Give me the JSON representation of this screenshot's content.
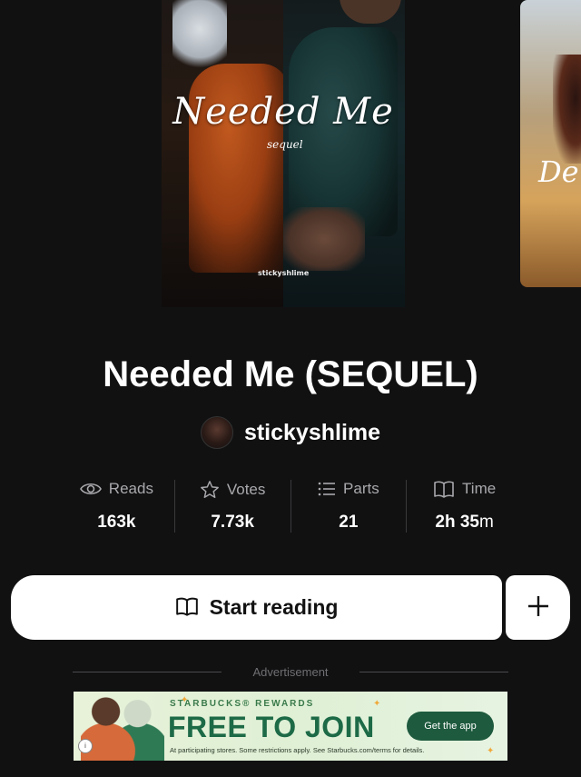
{
  "cover": {
    "title": "Needed Me",
    "subtitle": "sequel",
    "author_tag": "stickyshlime"
  },
  "next_cover": {
    "title_fragment": "De"
  },
  "story": {
    "title": "Needed Me (SEQUEL)",
    "author": "stickyshlime"
  },
  "stats": {
    "reads": {
      "label": "Reads",
      "value": "163k",
      "icon": "eye-icon"
    },
    "votes": {
      "label": "Votes",
      "value": "7.73k",
      "icon": "star-icon"
    },
    "parts": {
      "label": "Parts",
      "value": "21",
      "icon": "list-icon"
    },
    "time": {
      "label": "Time",
      "value_h": "2h 35",
      "value_unit": "m",
      "icon": "book-icon"
    }
  },
  "actions": {
    "start_label": "Start reading",
    "add_icon": "plus-icon"
  },
  "ad": {
    "label": "Advertisement",
    "brand": "STARBUCKS® REWARDS",
    "headline": "FREE TO JOIN",
    "cta": "Get the app",
    "fine_print": "At participating stores. Some restrictions apply. See Starbucks.com/terms for details."
  }
}
